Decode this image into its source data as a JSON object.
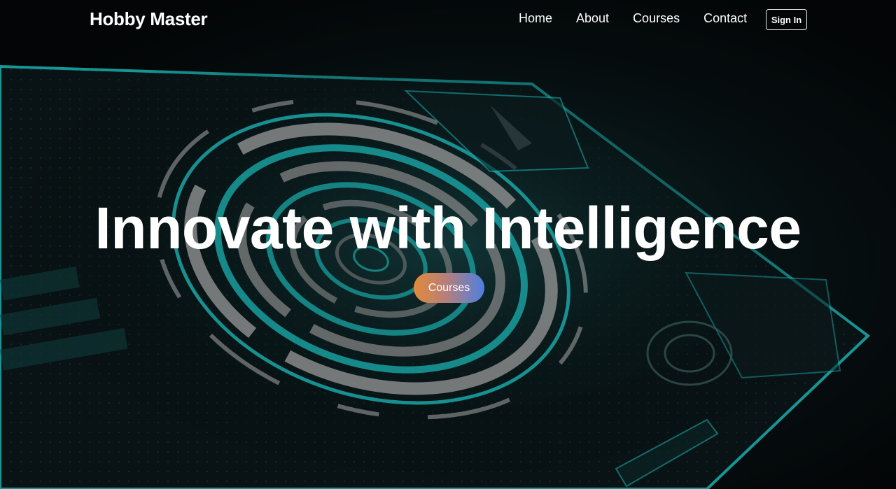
{
  "nav": {
    "brand": "Hobby Master",
    "links": [
      {
        "label": "Home"
      },
      {
        "label": "About"
      },
      {
        "label": "Courses"
      },
      {
        "label": "Contact"
      }
    ],
    "signin_label": "Sign In"
  },
  "hero": {
    "title": "Innovate with Intelligence",
    "cta_label": "Courses",
    "background": "futuristic-hud-interface-image"
  },
  "colors": {
    "background": "#050708",
    "accent_teal": "#1fb3b0",
    "cta_gradient_start": "#e28a3a",
    "cta_gradient_end": "#4e7fe0",
    "text": "#ffffff"
  }
}
